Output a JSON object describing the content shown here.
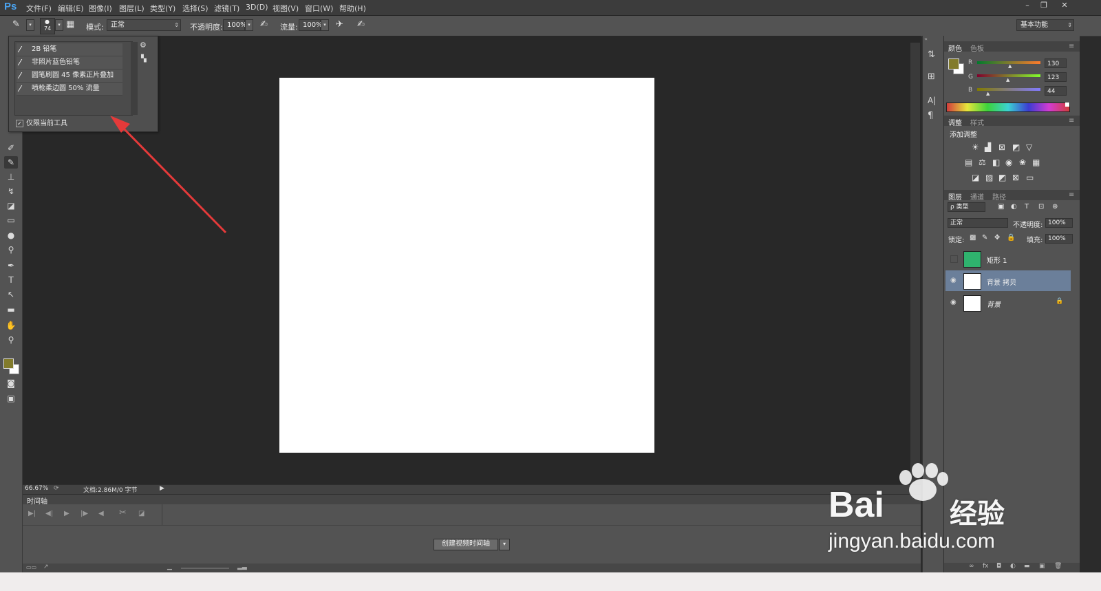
{
  "app": {
    "logo": "Ps"
  },
  "menu": [
    "文件(F)",
    "编辑(E)",
    "图像(I)",
    "图层(L)",
    "类型(Y)",
    "选择(S)",
    "滤镜(T)",
    "3D(D)",
    "视图(V)",
    "窗口(W)",
    "帮助(H)"
  ],
  "window_controls": {
    "minimize": "–",
    "restore": "❐",
    "close": "✕"
  },
  "options_bar": {
    "brush_size": "74",
    "mode_label": "模式:",
    "mode_value": "正常",
    "opacity_label": "不透明度:",
    "opacity_value": "100%",
    "flow_label": "流量:",
    "flow_value": "100%",
    "workspace": "基本功能"
  },
  "tool_presets": {
    "items": [
      "2B 铅笔",
      "非照片蓝色铅笔",
      "圆笔刷圆 45 像素正片叠加",
      "喷枪柔边圆 50% 流量"
    ],
    "only_current_tool": "仅限当前工具",
    "only_current_checked": true
  },
  "status": {
    "zoom": "66.67%",
    "doc": "文档:2.86M/0 字节"
  },
  "timeline": {
    "tab": "时间轴",
    "create_button": "创建视频时间轴"
  },
  "color_panel": {
    "tabs": [
      "颜色",
      "色板"
    ],
    "r_label": "R",
    "g_label": "G",
    "b_label": "B",
    "r": "130",
    "g": "123",
    "b": "44",
    "foreground": "#827b2c"
  },
  "adjustments_panel": {
    "tabs": [
      "调整",
      "样式"
    ],
    "title": "添加调整"
  },
  "layers_panel": {
    "tabs": [
      "图层",
      "通道",
      "路径"
    ],
    "filter_kind": "ρ 类型",
    "blend_mode": "正常",
    "opacity_label": "不透明度:",
    "opacity_value": "100%",
    "lock_label": "锁定:",
    "fill_label": "填充:",
    "fill_value": "100%",
    "layers": [
      {
        "name": "矩形 1",
        "visible": false,
        "thumb": "#2fb36e"
      },
      {
        "name": "背景 拷贝",
        "visible": true,
        "thumb": "#ffffff",
        "selected": true
      },
      {
        "name": "背景",
        "visible": true,
        "thumb": "#ffffff",
        "locked": true
      }
    ]
  },
  "watermark": {
    "brand": "Bai",
    "brand_suffix": "经验",
    "url": "jingyan.baidu.com"
  },
  "colors": {
    "annotation_arrow": "#e53a3a",
    "selected_layer": "#6b7f9a",
    "canvas": "#ffffff"
  }
}
